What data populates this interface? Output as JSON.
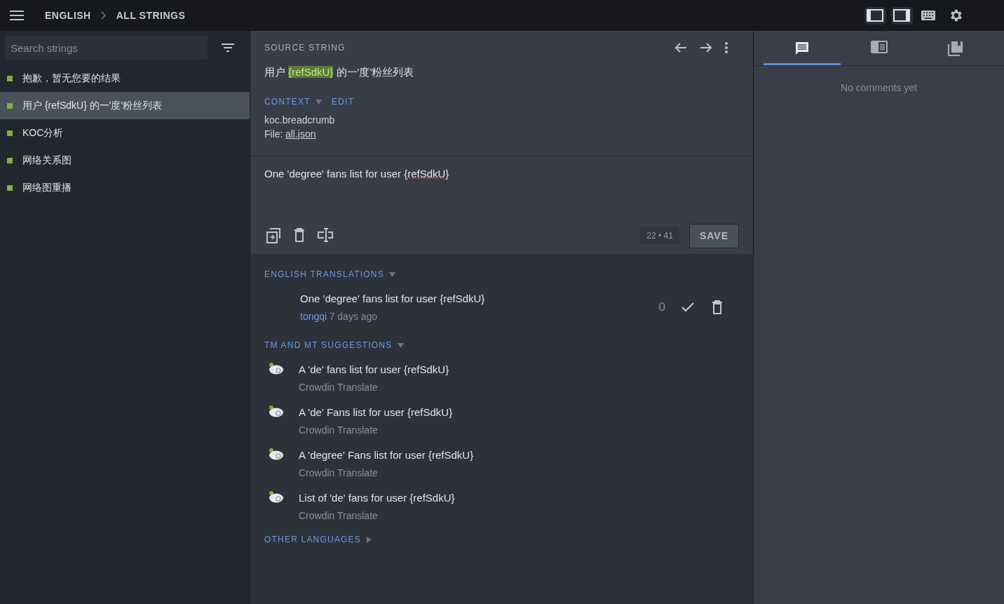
{
  "topbar": {
    "breadcrumb": [
      "ENGLISH",
      "ALL STRINGS"
    ]
  },
  "sidebar": {
    "search": {
      "placeholder": "Search strings"
    },
    "items": [
      {
        "label": "抱歉，暂无您要的结果",
        "color": "#7cb342",
        "selected": false
      },
      {
        "label": "用户 {refSdkU} 的一'度'粉丝列表",
        "color": "#7cb342",
        "selected": true
      },
      {
        "label": "KOC分析",
        "color": "#7cb342",
        "selected": false
      },
      {
        "label": "网络关系图",
        "color": "#7cb342",
        "selected": false
      },
      {
        "label": "网络图重播",
        "color": "#7cb342",
        "selected": false
      }
    ]
  },
  "source": {
    "heading": "SOURCE STRING",
    "text": [
      {
        "kind": "plain",
        "text": "用户 "
      },
      {
        "kind": "placeholder",
        "text": "{refSdkU}"
      },
      {
        "kind": "plain",
        "text": " 的一'度'粉丝列表"
      }
    ],
    "context_label": "CONTEXT",
    "edit_label": "EDIT",
    "context_key": "koc.breadcrumb",
    "file_label": "File:",
    "file_link": "all.json"
  },
  "editor": {
    "text": [
      {
        "kind": "plain",
        "text": "One 'degree' fans list for user "
      },
      {
        "kind": "misspelled",
        "text": "{refSdkU}"
      }
    ],
    "counter": [
      "22",
      "41"
    ],
    "counter_separator": "•",
    "save_label": "SAVE"
  },
  "translations": {
    "heading": "ENGLISH TRANSLATIONS",
    "items": [
      {
        "text": "One 'degree' fans list for user {refSdkU}",
        "author": "tongqi",
        "time": "7 days ago",
        "votes": "0"
      }
    ]
  },
  "suggestions": {
    "heading": "TM AND MT SUGGESTIONS",
    "items": [
      {
        "text": "A 'de' fans list for user {refSdkU}",
        "source": "Crowdin Translate"
      },
      {
        "text": "A 'de' Fans list for user {refSdkU}",
        "source": "Crowdin Translate"
      },
      {
        "text": "A 'degree' Fans list for user {refSdkU}",
        "source": "Crowdin Translate"
      },
      {
        "text": "List of 'de' fans for user {refSdkU}",
        "source": "Crowdin Translate"
      }
    ]
  },
  "other_languages": {
    "heading": "OTHER LANGUAGES",
    "expanded": false
  },
  "right_panel": {
    "tabs": [
      {
        "kind": "comments",
        "selected": true
      },
      {
        "kind": "details",
        "selected": false
      },
      {
        "kind": "glossary",
        "selected": false
      }
    ],
    "empty_message": "No comments yet"
  }
}
